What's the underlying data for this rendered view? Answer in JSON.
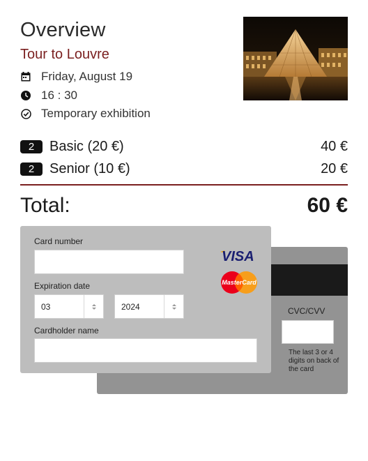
{
  "overview": {
    "title": "Overview",
    "tour_name": "Tour to Louvre",
    "photo": "louvre-pyramid-night"
  },
  "details": [
    {
      "icon": "calendar-icon",
      "text": "Friday, August 19"
    },
    {
      "icon": "clock-icon",
      "text": "16 : 30"
    },
    {
      "icon": "check-circle-icon",
      "text": "Temporary exhibition"
    }
  ],
  "tickets": [
    {
      "qty": "2",
      "label": "Basic (20 €)",
      "price": "40 €"
    },
    {
      "qty": "2",
      "label": "Senior (10 €)",
      "price": "20 €"
    }
  ],
  "total": {
    "label": "Total:",
    "value": "60 €"
  },
  "payment": {
    "card_number_label": "Card number",
    "card_number_value": "",
    "expiration_label": "Expiration date",
    "exp_month": "03",
    "exp_year": "2024",
    "cardholder_label": "Cardholder name",
    "cardholder_value": "",
    "cvc_label": "CVC/CVV",
    "cvc_value": "",
    "cvc_hint": "The last 3 or 4 digits on back of the card",
    "brands": [
      "VISA",
      "MasterCard"
    ]
  },
  "colors": {
    "accent": "#7a1f1f",
    "card_front": "#bdbdbd",
    "card_back": "#939393",
    "stripe": "#1a1a1a"
  }
}
